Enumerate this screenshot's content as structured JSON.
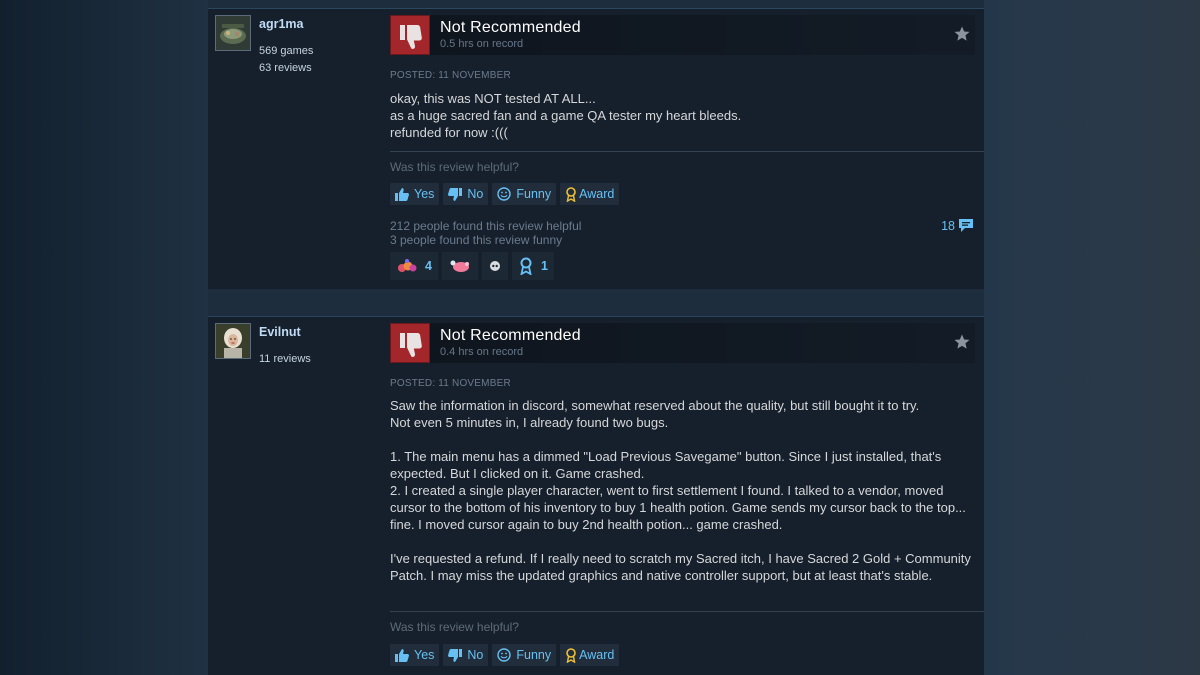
{
  "labels": {
    "helpful_question": "Was this review helpful?",
    "yes": "Yes",
    "no": "No",
    "funny": "Funny",
    "award": "Award"
  },
  "colors": {
    "negative_thumb": "#a3262a",
    "link_blue": "#66c0f4",
    "background": "#1b2838"
  },
  "reviews": [
    {
      "author": {
        "name": "agr1ma",
        "games": "569 games",
        "reviews": "63 reviews"
      },
      "verdict": "Not Recommended",
      "hours": "0.5 hrs on record",
      "posted": "POSTED: 11 NOVEMBER",
      "text": "okay, this was NOT tested AT ALL...\nas a huge sacred fan and a game QA tester my heart bleeds.\nrefunded for now :(((",
      "found_helpful": "212 people found this review helpful",
      "found_funny": "3 people found this review funny",
      "comment_count": "18",
      "awards": [
        {
          "icon": "candy-award-icon",
          "count": "4"
        },
        {
          "icon": "heart-award-icon",
          "count": ""
        },
        {
          "icon": "eye-award-icon",
          "count": ""
        },
        {
          "icon": "ribbon-award-icon",
          "count": "1"
        }
      ]
    },
    {
      "author": {
        "name": "Evilnut",
        "reviews": "11 reviews"
      },
      "verdict": "Not Recommended",
      "hours": "0.4 hrs on record",
      "posted": "POSTED: 11 NOVEMBER",
      "text": "Saw the information in discord, somewhat reserved about the quality, but still bought it to try.\nNot even 5 minutes in, I already found two bugs.\n\n1. The main menu has a dimmed \"Load Previous Savegame\" button. Since I just installed, that's expected. But I clicked on it. Game crashed.\n2. I created a single player character, went to first settlement I found. I talked to a vendor, moved cursor to the bottom of his inventory to buy 1 health potion. Game sends my cursor back to the top... fine. I moved cursor again to buy 2nd health potion... game crashed.\n\nI've requested a refund. If I really need to scratch my Sacred itch, I have Sacred 2 Gold + Community Patch. I may miss the updated graphics and native controller support, but at least that's stable."
    }
  ]
}
